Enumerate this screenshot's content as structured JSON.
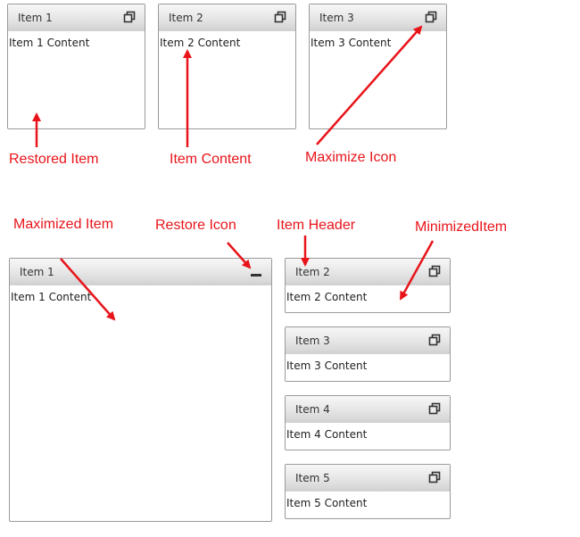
{
  "top_row": [
    {
      "title": "Item 1",
      "content": "Item 1 Content"
    },
    {
      "title": "Item 2",
      "content": "Item 2 Content"
    },
    {
      "title": "Item 3",
      "content": "Item 3 Content"
    }
  ],
  "bottom_layout": {
    "maximized": {
      "title": "Item 1",
      "content": "Item 1 Content"
    },
    "minimized": [
      {
        "title": "Item 2",
        "content": "Item 2 Content"
      },
      {
        "title": "Item 3",
        "content": "Item 3 Content"
      },
      {
        "title": "Item 4",
        "content": "Item 4 Content"
      },
      {
        "title": "Item 5",
        "content": "Item 5 Content"
      }
    ]
  },
  "annotations": {
    "restored_item": "Restored Item",
    "item_content": "Item Content",
    "maximize_icon": "Maximize Icon",
    "maximized_item": "Maximized Item",
    "restore_icon": "Restore Icon",
    "item_header": "Item Header",
    "minimized_item": "MinimizedItem"
  },
  "colors": {
    "annotation": "#e8141a",
    "tile_border": "#9a9a9a",
    "header_top": "#f7f7f7",
    "header_bottom": "#d6d6d6"
  },
  "icons": {
    "maximize": "maximize-icon",
    "restore": "restore-icon"
  }
}
